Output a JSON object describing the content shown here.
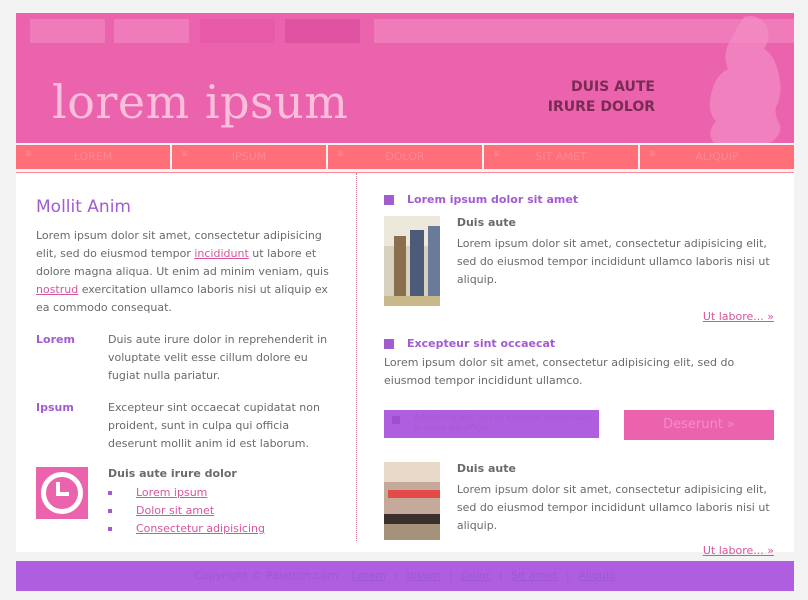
{
  "header": {
    "brand": "lorem ipsum",
    "tagline_line1": "DUIS AUTE",
    "tagline_line2": "IRURE DOLOR"
  },
  "main_nav": [
    {
      "label": "LOREM"
    },
    {
      "label": "IPSUM"
    },
    {
      "label": "DOLOR"
    },
    {
      "label": "SIT AMET"
    },
    {
      "label": "ALIQUIP"
    }
  ],
  "left": {
    "title": "Mollit Anim",
    "intro_part1": "Lorem ipsum dolor sit amet, consectetur adipisicing elit, sed do eiusmod tempor",
    "intro_link1": "incididunt",
    "intro_part2": "ut labore et dolore magna aliqua. Ut enim ad minim veniam, quis",
    "intro_link2": "nostrud",
    "intro_part3": "exercitation ullamco laboris nisi ut aliquip ex ea commodo consequat.",
    "defs": [
      {
        "term": "Lorem",
        "desc": "Duis aute irure dolor in reprehenderit in voluptate velit esse cillum dolore eu fugiat nulla pariatur."
      },
      {
        "term": "Ipsum",
        "desc": "Excepteur sint occaecat cupidatat non proident, sunt in culpa qui officia deserunt mollit anim id est laborum."
      }
    ],
    "links_title": "Duis aute irure dolor",
    "links": [
      "Lorem ipsum",
      "Dolor sit amet",
      "Consectetur adipisicing"
    ]
  },
  "right": {
    "section1_title": "Lorem ipsum dolor sit amet",
    "feature1": {
      "heading": "Duis aute",
      "text": "Lorem ipsum dolor sit amet, consectetur adipisicing elit, sed do eiusmod tempor incididunt ullamco laboris nisi ut aliquip.",
      "more": "Ut labore... »"
    },
    "section2_title": "Excepteur sint occaecat",
    "section2_text": "Lorem ipsum dolor sit amet, consectetur adipisicing elit, sed do eiusmod tempor incididunt ullamco.",
    "notice": "Adipisicing elit, sed do eiusmod tempor sunt in culpa qui officia.",
    "cta": "Deserunt »",
    "feature2": {
      "heading": "Duis aute",
      "text": "Lorem ipsum dolor sit amet, consectetur adipisicing elit, sed do eiusmod tempor incididunt ullamco laboris nisi ut aliquip.",
      "more": "Ut labore... »"
    }
  },
  "footer": {
    "copyright": "Copyright © Paletton.com",
    "links": [
      "Lorem",
      "Ipsum",
      "Dolor",
      "Sit amet",
      "Aliquip"
    ]
  },
  "colors": {
    "pink": "#ec63ad",
    "purple": "#a35bd0",
    "coral": "#ff6f7a",
    "footer_purple": "#b05ee0"
  },
  "icons": [
    "clock-icon"
  ]
}
